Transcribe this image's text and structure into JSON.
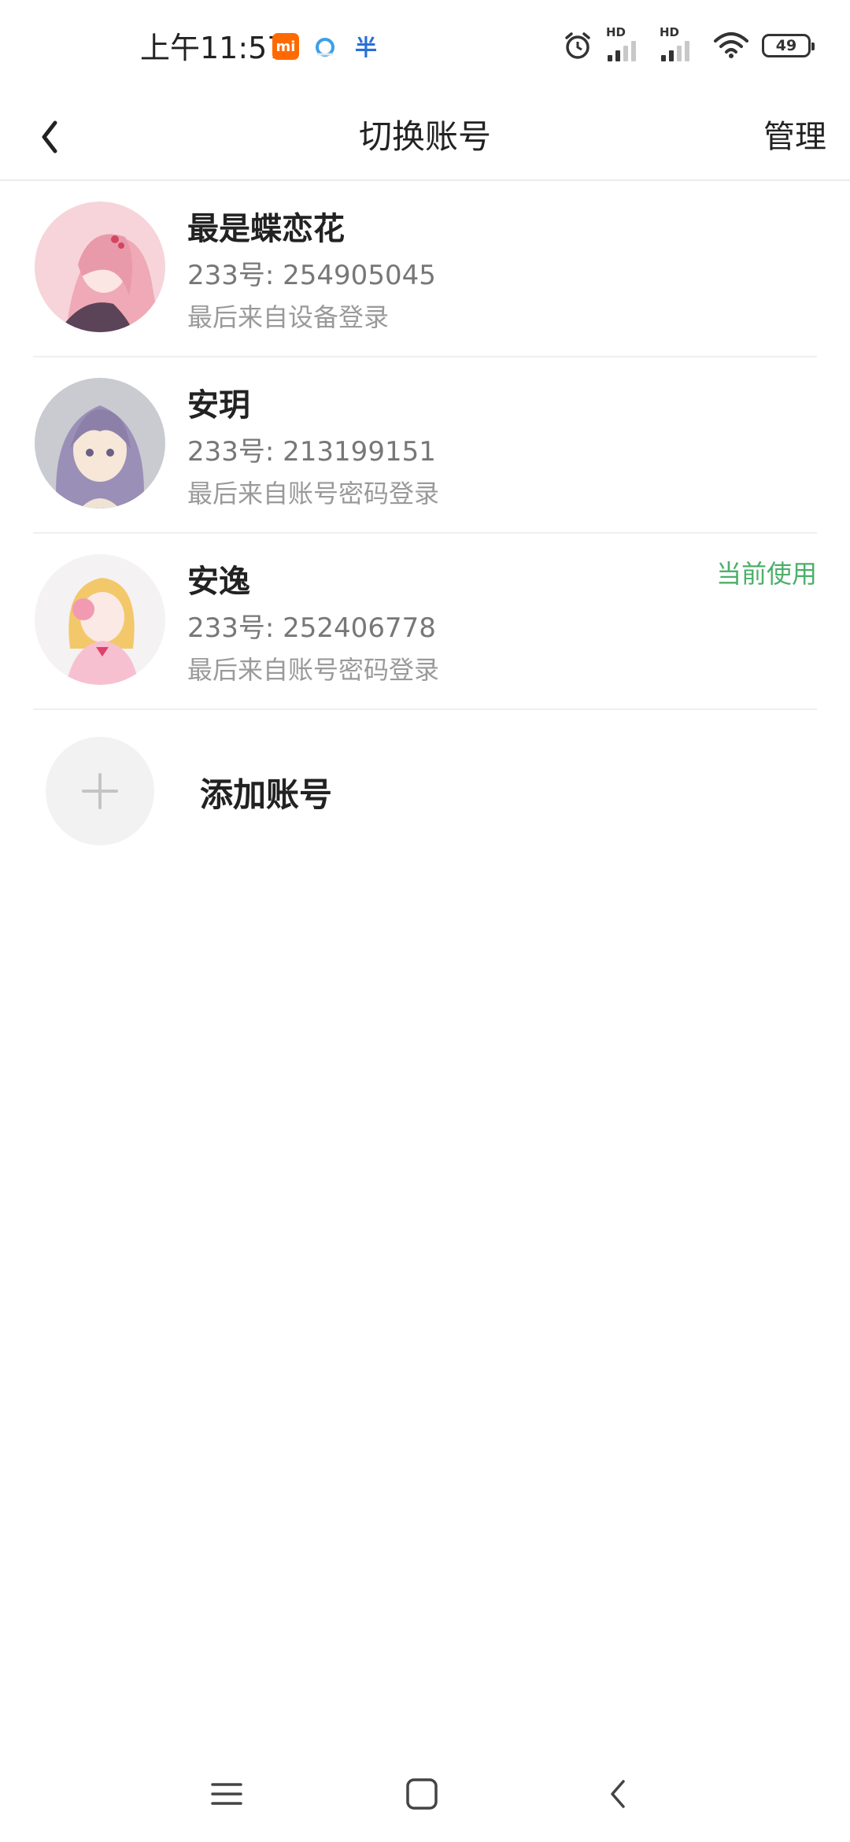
{
  "status_bar": {
    "time": "上午11:57",
    "app_badges": [
      "mi",
      "Q",
      "半"
    ],
    "battery": "49",
    "signal_labels": [
      "HD",
      "HD"
    ]
  },
  "header": {
    "title": "切换账号",
    "manage_label": "管理"
  },
  "accounts": [
    {
      "name": "最是蝶恋花",
      "id_text": "233号: 254905045",
      "login_text": "最后来自设备登录",
      "current": ""
    },
    {
      "name": "安玥",
      "id_text": "233号: 213199151",
      "login_text": "最后来自账号密码登录",
      "current": ""
    },
    {
      "name": "安逸",
      "id_text": "233号: 252406778",
      "login_text": "最后来自账号密码登录",
      "current": "当前使用"
    }
  ],
  "add_account": {
    "label": "添加账号",
    "icon": "plus-icon"
  },
  "nav_icons": [
    "menu-icon",
    "home-icon",
    "back-icon"
  ],
  "colors": {
    "current_green": "#4caf6a",
    "mi_orange": "#ff6a00"
  }
}
